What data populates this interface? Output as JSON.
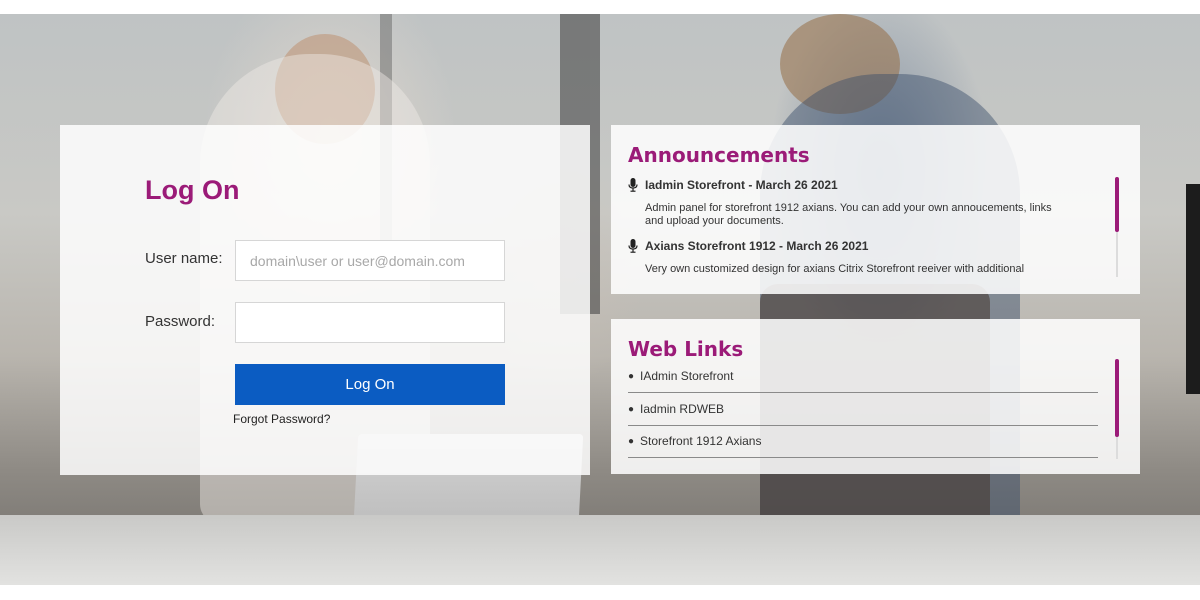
{
  "login": {
    "title": "Log On",
    "username_label": "User name:",
    "username_placeholder": "domain\\user or user@domain.com",
    "username_value": "",
    "password_label": "Password:",
    "password_value": "",
    "submit_label": "Log On",
    "forgot_label": "Forgot Password?"
  },
  "announcements": {
    "title": "Announcements",
    "items": [
      {
        "icon": "microphone-icon",
        "heading": "Iadmin Storefront - March 26 2021",
        "body": "Admin panel for storefront 1912 axians. You can add your own annoucements, links and upload your documents."
      },
      {
        "icon": "microphone-icon",
        "heading": "Axians Storefront 1912 - March 26 2021",
        "body": "Very own customized design for axians Citrix Storefront reeiver with additional"
      }
    ]
  },
  "weblinks": {
    "title": "Web Links",
    "items": [
      {
        "label": "IAdmin Storefront"
      },
      {
        "label": "Iadmin RDWEB"
      },
      {
        "label": "Storefront 1912 Axians"
      }
    ]
  },
  "colors": {
    "accent": "#9b1b78",
    "button": "#0b5cc2"
  }
}
